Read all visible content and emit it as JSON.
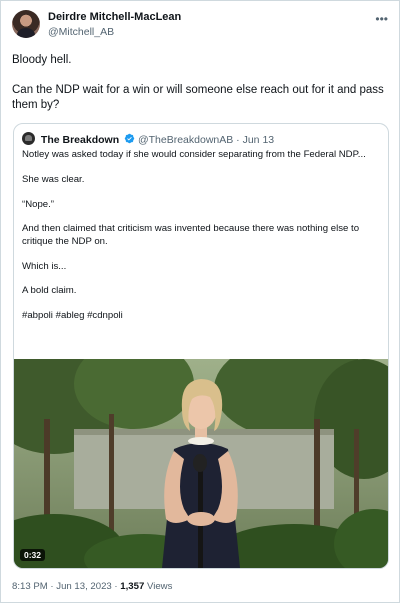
{
  "author": {
    "name": "Deirdre Mitchell-MacLean",
    "handle": "@Mitchell_AB"
  },
  "tweet": {
    "lines": [
      "Bloody hell.",
      "Can the NDP wait for a win or will someone else reach out for it and pass them by?"
    ]
  },
  "quote": {
    "name": "The Breakdown",
    "handle": "@TheBreakdownAB",
    "dot": "·",
    "date": "Jun 13",
    "paragraphs": [
      "Notley was asked today if she would consider separating from the Federal NDP...",
      "She was clear.",
      "“Nope.”",
      "And then claimed that criticism was invented because there was nothing else to critique the NDP on.",
      "Which is...",
      "A bold claim.",
      "#abpoli #ableg #cdnpoli"
    ],
    "video": {
      "duration": "0:32"
    }
  },
  "meta": {
    "time": "8:13 PM",
    "sep1": " · ",
    "date": "Jun 13, 2023",
    "sep2": " · ",
    "views": "1,357",
    "views_label": " Views"
  },
  "colors": {
    "text": "#0f1419",
    "secondary": "#536471",
    "border": "#cfd9de",
    "verified": "#1d9bf0"
  },
  "icons": {
    "more": "more-icon",
    "verified": "verified-badge-icon",
    "play": "video"
  }
}
